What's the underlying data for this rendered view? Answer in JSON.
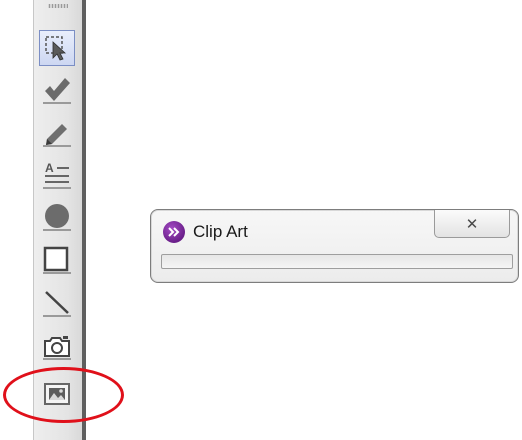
{
  "toolbar": {
    "tools": [
      {
        "name": "select-tool",
        "icon": "selection-arrow-icon",
        "selected": true
      },
      {
        "name": "checkmark-tool",
        "icon": "checkmark-icon",
        "selected": false
      },
      {
        "name": "pencil-tool",
        "icon": "pencil-icon",
        "selected": false
      },
      {
        "name": "text-tool",
        "icon": "text-icon",
        "selected": false
      },
      {
        "name": "ellipse-tool",
        "icon": "circle-icon",
        "selected": false
      },
      {
        "name": "rectangle-tool",
        "icon": "square-icon",
        "selected": false
      },
      {
        "name": "line-tool",
        "icon": "line-icon",
        "selected": false
      },
      {
        "name": "camera-tool",
        "icon": "camera-icon",
        "selected": false
      },
      {
        "name": "clip-art-tool",
        "icon": "clip-art-icon",
        "selected": false,
        "highlighted": true
      }
    ],
    "text_icon_letter": "A"
  },
  "popup": {
    "title": "Clip Art",
    "close_symbol": "✕",
    "progress": 0
  },
  "colors": {
    "highlight": "#e0101a",
    "logo": "#7a2a9c"
  }
}
